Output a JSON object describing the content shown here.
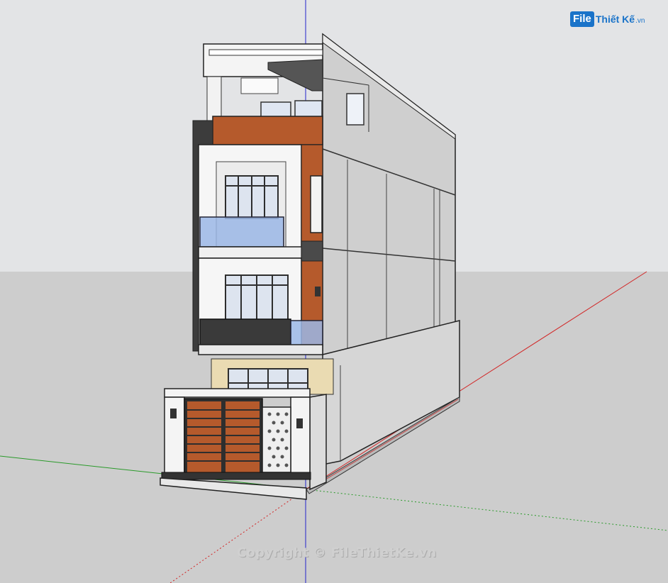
{
  "viewport": {
    "sky_color": "#e3e4e6",
    "ground_color": "#cdcdcd",
    "axis_colors": {
      "red": "#d22424",
      "green": "#2a9a2a",
      "blue": "#2222cc"
    }
  },
  "logo": {
    "box_text": "File",
    "rest_text": "Thiết Kế",
    "suffix": ".vn",
    "brand_color": "#1a73c9"
  },
  "watermark": {
    "text": "Copyright © FileThietKe.vn"
  },
  "model": {
    "description_icon": "house-3d-model-icon",
    "wood_color": "#b55a2c",
    "wall_color": "#cfcfcf",
    "glass_color": "#9bb7e6",
    "frame_color": "#3a3a3a"
  }
}
